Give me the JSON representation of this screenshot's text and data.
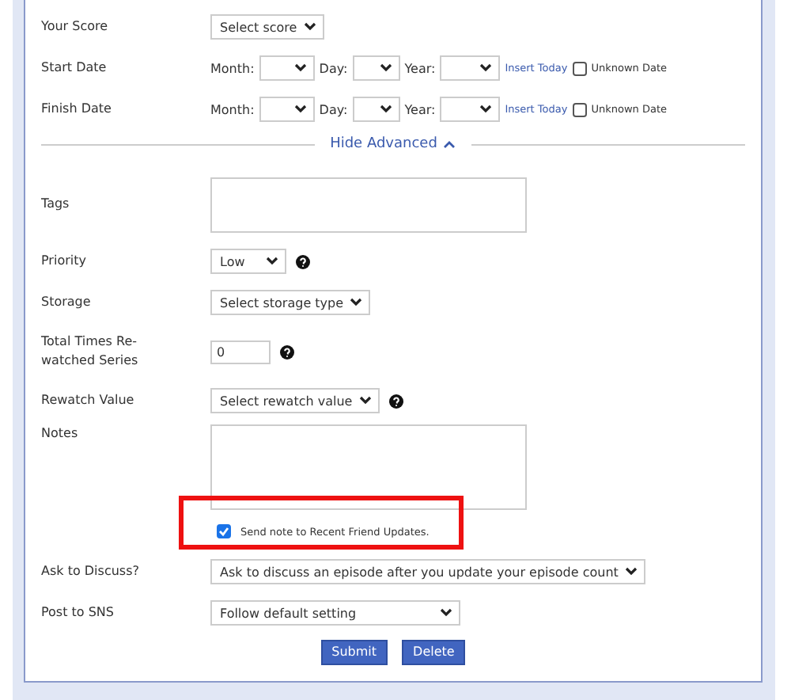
{
  "form_top": [
    {
      "kind": "select",
      "label": "Your Score",
      "value": "Select score"
    },
    {
      "kind": "date",
      "label": "Start Date",
      "month_label": "Month:",
      "day_label": "Day:",
      "year_label": "Year:",
      "link": "Insert Today",
      "unknown_label": "Unknown Date",
      "unknown_checked": false
    },
    {
      "kind": "date",
      "label": "Finish Date",
      "month_label": "Month:",
      "day_label": "Day:",
      "year_label": "Year:",
      "link": "Insert Today",
      "unknown_label": "Unknown Date",
      "unknown_checked": false
    }
  ],
  "advanced_toggle": {
    "label": "Hide Advanced",
    "expanded": true
  },
  "form_advanced": [
    {
      "kind": "textarea",
      "label": "Tags"
    },
    {
      "kind": "select",
      "label": "Priority",
      "value": "Low",
      "help": true
    },
    {
      "kind": "select",
      "label": "Storage",
      "value": "Select storage type"
    },
    {
      "kind": "number",
      "label": "Total Times Re-watched Series",
      "value": "0",
      "help": true
    },
    {
      "kind": "select",
      "label": "Rewatch Value",
      "value": "Select rewatch value",
      "help": true
    },
    {
      "kind": "notes",
      "label": "Notes",
      "option_label": "Send note to Recent Friend Updates.",
      "option_checked": true,
      "highlighted": true
    },
    {
      "kind": "select",
      "label": "Ask to Discuss?",
      "value": "Ask to discuss an episode after you update your episode count"
    },
    {
      "kind": "select",
      "label": "Post to SNS",
      "value": "Follow default setting",
      "wide": true
    }
  ],
  "buttons": [
    "Submit",
    "Delete"
  ]
}
